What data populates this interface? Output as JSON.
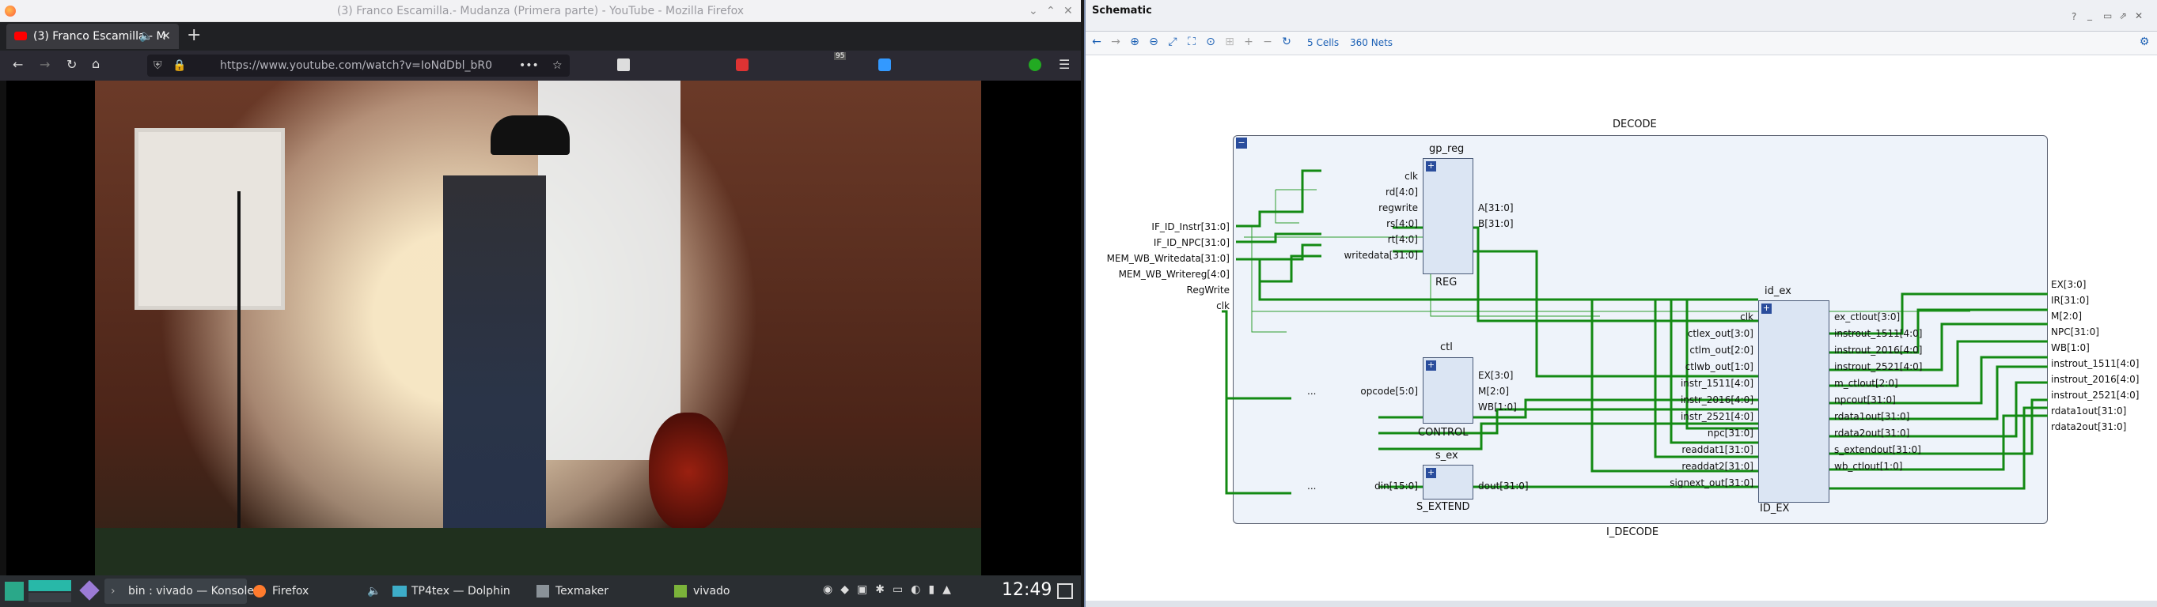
{
  "firefox": {
    "title": "(3) Franco Escamilla.- Mudanza (Primera parte) - YouTube - Mozilla Firefox",
    "tab_title": "(3) Franco Escamilla.- M",
    "url": "https://www.youtube.com/watch?v=IoNdDbl_bR0",
    "ext_badge": "95"
  },
  "taskbar": {
    "items": [
      "bin : vivado — Konsole",
      "Firefox",
      "TP4tex — Dolphin",
      "Texmaker",
      "vivado"
    ],
    "clock": "12:49"
  },
  "vivado": {
    "panel_title": "Schematic",
    "cells": "5 Cells",
    "nets": "360 Nets",
    "decode_title": "DECODE",
    "decode_instance": "I_DECODE",
    "ports_left": [
      "IF_ID_Instr[31:0]",
      "IF_ID_NPC[31:0]",
      "MEM_WB_Writedata[31:0]",
      "MEM_WB_Writereg[4:0]",
      "RegWrite",
      "clk"
    ],
    "ports_right": [
      "EX[3:0]",
      "IR[31:0]",
      "M[2:0]",
      "NPC[31:0]",
      "WB[1:0]",
      "instrout_1511[4:0]",
      "instrout_2016[4:0]",
      "instrout_2521[4:0]",
      "rdata1out[31:0]",
      "rdata2out[31:0]"
    ],
    "gp_reg": {
      "name": "gp_reg",
      "type": "REG",
      "inputs": [
        "clk",
        "rd[4:0]",
        "regwrite",
        "rs[4:0]",
        "rt[4:0]",
        "writedata[31:0]"
      ],
      "outputs": [
        "A[31:0]",
        "B[31:0]"
      ]
    },
    "ctl": {
      "name": "ctl",
      "type": "CONTROL",
      "inputs": [
        "opcode[5:0]"
      ],
      "outputs": [
        "EX[3:0]",
        "M[2:0]",
        "WB[1:0]"
      ]
    },
    "s_ex": {
      "name": "s_ex",
      "type": "S_EXTEND",
      "inputs": [
        "din[15:0]"
      ],
      "outputs": [
        "dout[31:0]"
      ]
    },
    "id_ex": {
      "name": "id_ex",
      "type": "ID_EX",
      "inputs": [
        "clk",
        "ctlex_out[3:0]",
        "ctlm_out[2:0]",
        "ctlwb_out[1:0]",
        "instr_1511[4:0]",
        "instr_2016[4:0]",
        "instr_2521[4:0]",
        "npc[31:0]",
        "readdat1[31:0]",
        "readdat2[31:0]",
        "signext_out[31:0]"
      ],
      "outputs": [
        "ex_ctlout[3:0]",
        "instrout_1511[4:0]",
        "instrout_2016[4:0]",
        "instrout_2521[4:0]",
        "m_ctlout[2:0]",
        "npcout[31:0]",
        "rdata1out[31:0]",
        "rdata2out[31:0]",
        "s_extendout[31:0]",
        "wb_ctlout[1:0]"
      ]
    },
    "dots": "..."
  }
}
